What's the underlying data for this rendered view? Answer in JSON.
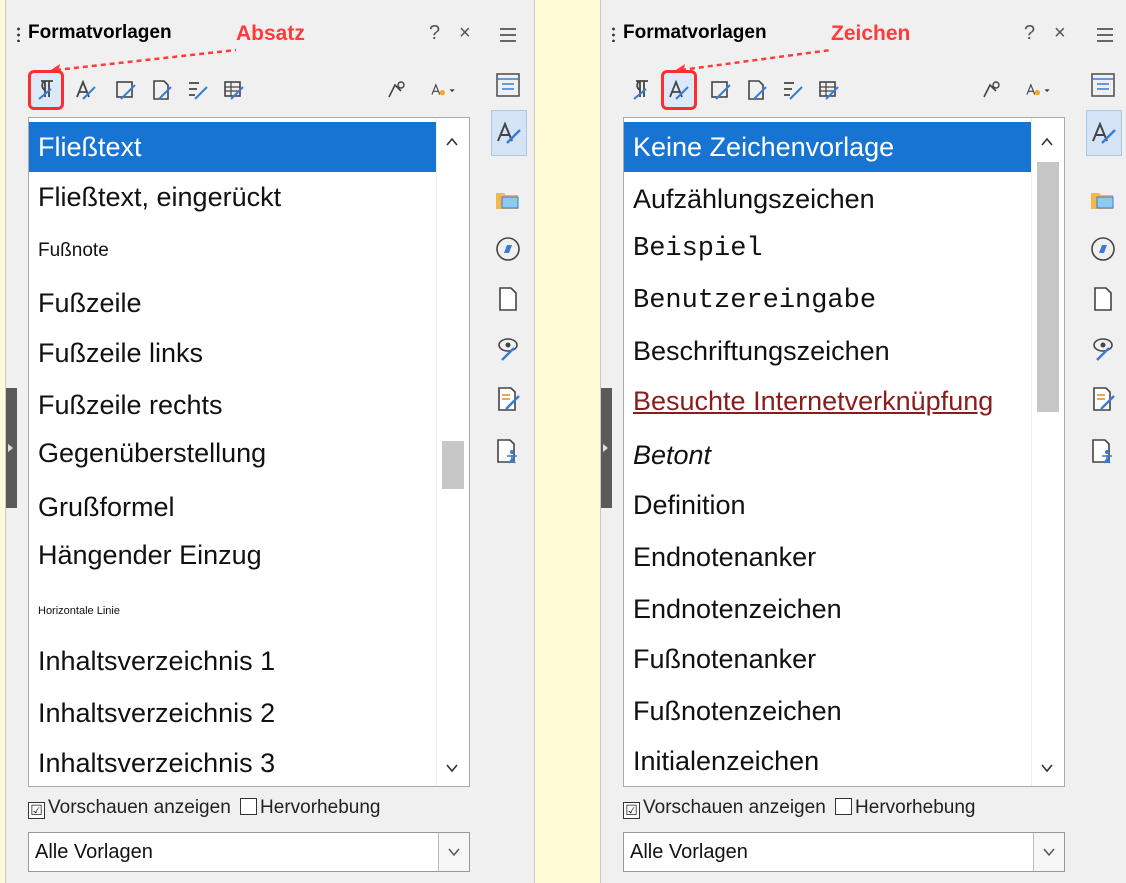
{
  "panels": [
    {
      "id": "left",
      "title": "Formatvorlagen",
      "annotation": "Absatz",
      "help": "?",
      "close": "×",
      "highlighted_tool": 0,
      "items": [
        {
          "label": "Fließtext",
          "selected": true
        },
        {
          "label": "Fließtext, eingerückt"
        },
        {
          "label": "Fußnote"
        },
        {
          "label": "Fußzeile"
        },
        {
          "label": "Fußzeile links"
        },
        {
          "label": "Fußzeile rechts"
        },
        {
          "label": "Gegenüberstellung"
        },
        {
          "label": "Grußformel"
        },
        {
          "label": "Hängender Einzug"
        },
        {
          "label": "Horizontale Linie"
        },
        {
          "label": "Inhaltsverzeichnis 1"
        },
        {
          "label": "Inhaltsverzeichnis 2"
        },
        {
          "label": "Inhaltsverzeichnis 3"
        }
      ],
      "scroll_position": 0.52,
      "show_preview": "Vorschauen anzeigen",
      "highlight": "Hervorhebung",
      "filter": "Alle Vorlagen"
    },
    {
      "id": "right",
      "title": "Formatvorlagen",
      "annotation": "Zeichen",
      "help": "?",
      "close": "×",
      "highlighted_tool": 1,
      "items": [
        {
          "label": "Keine Zeichenvorlage",
          "selected": true
        },
        {
          "label": "Aufzählungszeichen"
        },
        {
          "label": "Beispiel"
        },
        {
          "label": "Benutzereingabe"
        },
        {
          "label": "Beschriftungszeichen"
        },
        {
          "label": "Besuchte Internetverknüpfung"
        },
        {
          "label": "Betont"
        },
        {
          "label": "Definition"
        },
        {
          "label": "Endnotenanker"
        },
        {
          "label": "Endnotenzeichen"
        },
        {
          "label": "Fußnotenanker"
        },
        {
          "label": "Fußnotenzeichen"
        },
        {
          "label": "Initialenzeichen"
        }
      ],
      "scroll_position": 0.0,
      "show_preview": "Vorschauen anzeigen",
      "highlight": "Hervorhebung",
      "filter": "Alle Vorlagen"
    }
  ],
  "colors": {
    "accent": "#1874d2",
    "annotation": "#ff3a3a",
    "visited_link": "#8b1c1c"
  },
  "toolbar_icons": [
    "paragraph-styles-icon",
    "character-styles-icon",
    "frame-styles-icon",
    "page-styles-icon",
    "list-styles-icon",
    "table-styles-icon",
    "fill-format-icon",
    "styles-actions-icon"
  ],
  "sidebar_icons": [
    "properties-icon",
    "styles-icon",
    "gallery-icon",
    "navigator-icon",
    "page-icon",
    "style-inspector-icon",
    "manage-changes-icon",
    "accessibility-check-icon"
  ]
}
